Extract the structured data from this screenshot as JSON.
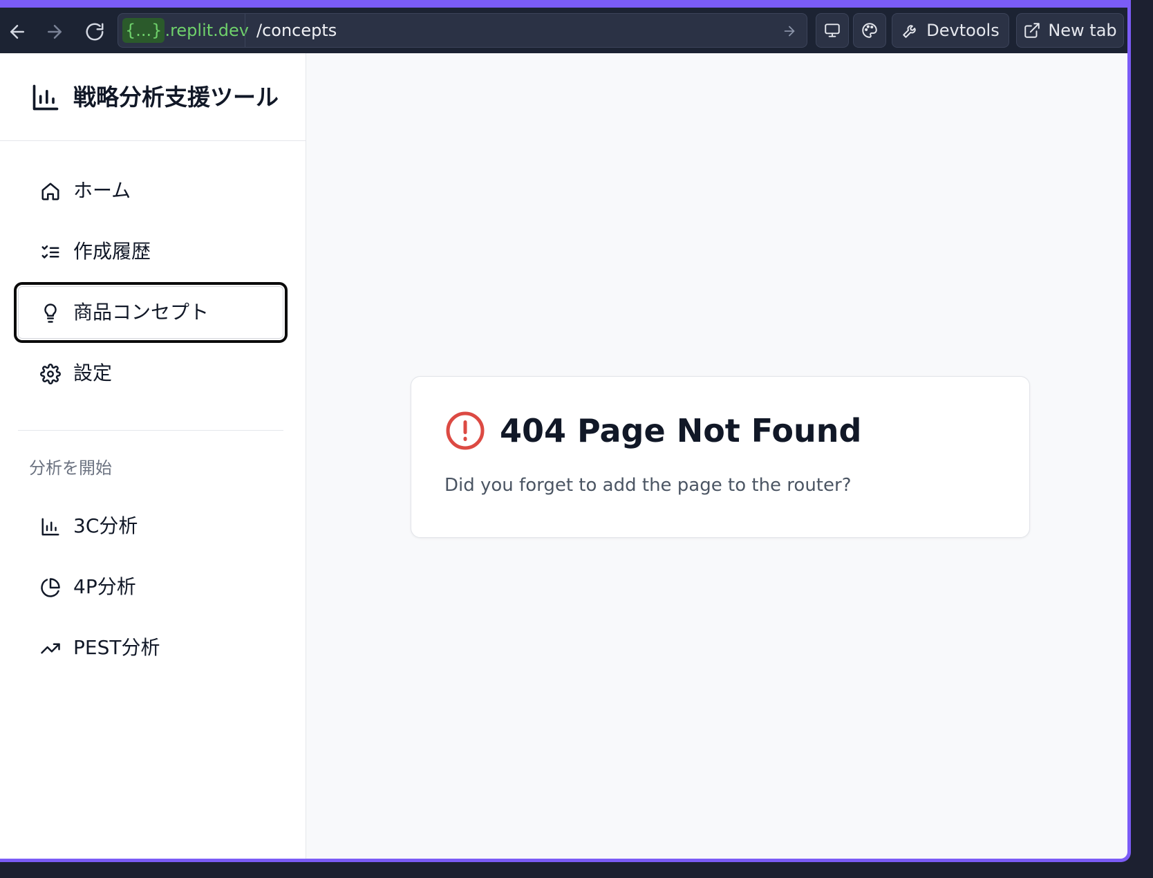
{
  "browser": {
    "url_host_highlight": "{...}",
    "url_host_rest": ".replit.dev",
    "url_path": "/concepts",
    "devtools_label": "Devtools",
    "new_tab_label": "New tab"
  },
  "sidebar": {
    "brand_title": "戦略分析支援ツール",
    "items": [
      {
        "label": "ホーム",
        "icon": "home-icon"
      },
      {
        "label": "作成履歴",
        "icon": "list-checks-icon"
      },
      {
        "label": "商品コンセプト",
        "icon": "lightbulb-icon",
        "active": true
      },
      {
        "label": "設定",
        "icon": "gear-icon"
      }
    ],
    "section_label": "分析を開始",
    "analysis_items": [
      {
        "label": "3C分析",
        "icon": "bar-chart-icon"
      },
      {
        "label": "4P分析",
        "icon": "pie-chart-icon"
      },
      {
        "label": "PEST分析",
        "icon": "trending-up-icon"
      }
    ]
  },
  "main": {
    "error_title": "404 Page Not Found",
    "error_message": "Did you forget to add the page to the router?"
  },
  "colors": {
    "accent_frame": "#7b5cf6",
    "toolbar_bg": "#1c2333",
    "error_red": "#dc4a43",
    "url_host_green": "#6fd16b"
  }
}
